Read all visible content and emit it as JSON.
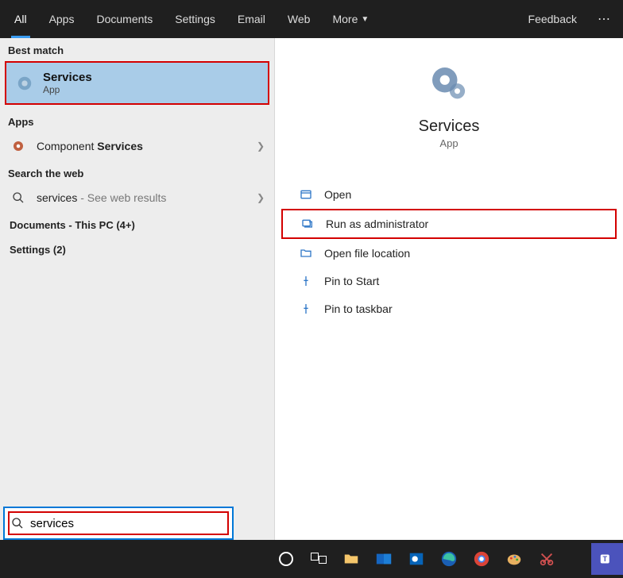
{
  "tabs": {
    "all": "All",
    "apps": "Apps",
    "documents": "Documents",
    "settings": "Settings",
    "email": "Email",
    "web": "Web",
    "more": "More"
  },
  "header": {
    "feedback": "Feedback"
  },
  "left": {
    "best_match_label": "Best match",
    "best_match": {
      "title": "Services",
      "subtitle": "App"
    },
    "apps_label": "Apps",
    "component_services_pre": "Component ",
    "component_services_bold": "Services",
    "search_web_label": "Search the web",
    "web_result_term": "services",
    "web_result_suffix": " - See web results",
    "documents_label": "Documents - This PC (4+)",
    "settings_label": "Settings (2)"
  },
  "preview": {
    "title": "Services",
    "subtitle": "App"
  },
  "actions": {
    "open": "Open",
    "run_admin": "Run as administrator",
    "open_location": "Open file location",
    "pin_start": "Pin to Start",
    "pin_taskbar": "Pin to taskbar"
  },
  "search": {
    "value": "services"
  }
}
